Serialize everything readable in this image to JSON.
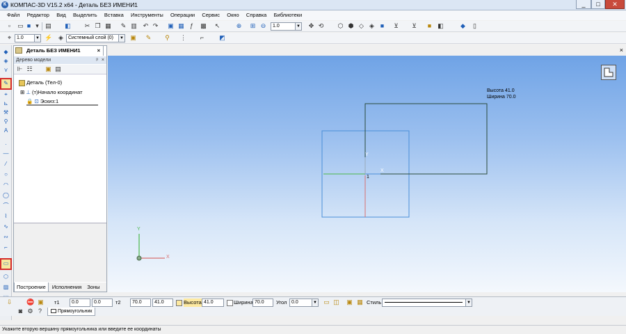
{
  "window": {
    "title": "КОМПАС-3D V15.2  x64 - Деталь БЕЗ ИМЕНИ1",
    "app_icon_letter": "К",
    "minimize": "_",
    "maximize": "□",
    "close": "✕"
  },
  "menu": [
    "Файл",
    "Редактор",
    "Вид",
    "Выделить",
    "Вставка",
    "Инструменты",
    "Операции",
    "Сервис",
    "Окно",
    "Справка",
    "Библиотеки"
  ],
  "toolbar1": {
    "zoom_value": "1.0"
  },
  "toolbar2": {
    "scale_value": "1.0",
    "layer_value": "Системный слой (0)"
  },
  "document_tab": {
    "label": "Деталь БЕЗ ИМЕНИ1",
    "close": "×"
  },
  "tree": {
    "header": "Дерево модели",
    "pin": "ᵖ",
    "close": "×",
    "nodes": [
      "Деталь (Тел-0)",
      "(т)Начало координат",
      "Эскиз:1"
    ],
    "tabs": [
      "Построение",
      "Исполнения",
      "Зоны"
    ]
  },
  "viewport": {
    "hint_height": "Высота 41.0",
    "hint_width": "Ширина 70.0",
    "point_label": "1",
    "axis_x": "X",
    "axis_y": "Y",
    "sketch_x": "X",
    "sketch_y": "Y"
  },
  "props": {
    "t1_label": "т1",
    "t1_x": "0.0",
    "t1_y": "0.0",
    "t2_label": "т2",
    "t2_x": "70.0",
    "t2_y": "41.0",
    "height_label": "Высота",
    "height_value": "41.0",
    "width_label": "Ширина",
    "width_value": "70.0",
    "angle_label": "Угол",
    "angle_value": "0.0",
    "style_label": "Стиль",
    "tab_label": "Прямоугольник"
  },
  "status": {
    "text": "Укажите вторую вершину прямоугольника или введите ее координаты"
  },
  "colors": {
    "sketch_blue": "#4a8fd8",
    "rect_dark": "#2a4a3a",
    "highlight": "#d42a2a"
  }
}
